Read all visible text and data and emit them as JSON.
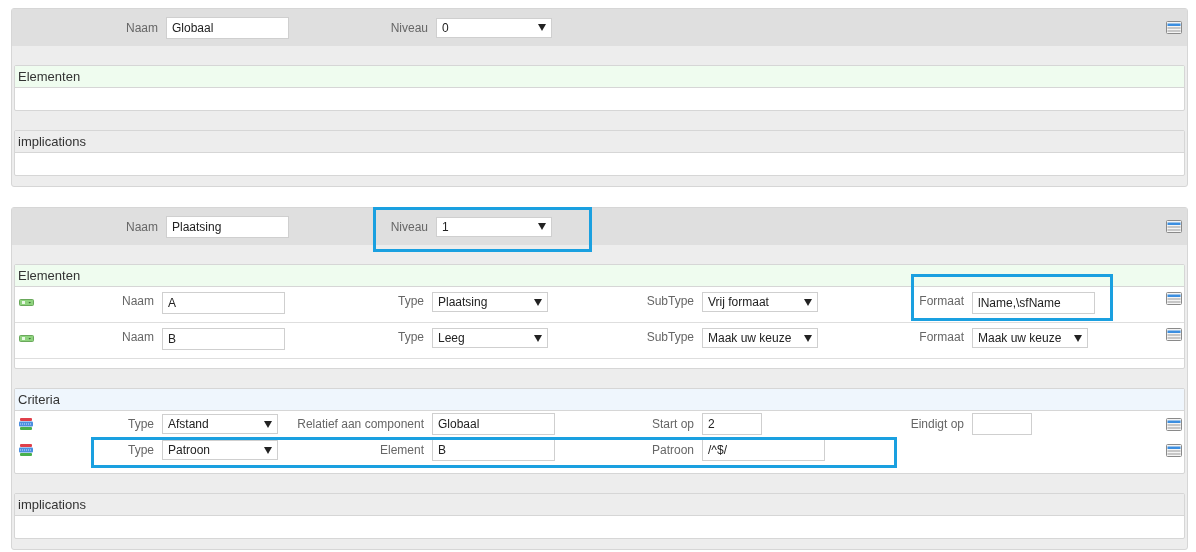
{
  "components": [
    {
      "header": {
        "fields": [
          {
            "label": "Naam",
            "kind": "text",
            "value": "Globaal",
            "highlighted": false
          },
          {
            "label": "Niveau",
            "kind": "select",
            "value": "0",
            "highlighted": false
          }
        ]
      },
      "sections": [
        {
          "kind": "elements",
          "title": "Elementen"
        },
        {
          "kind": "implications",
          "title": "implications"
        }
      ]
    },
    {
      "header": {
        "fields": [
          {
            "label": "Naam",
            "kind": "text",
            "value": "Plaatsing",
            "highlighted": false
          },
          {
            "label": "Niveau",
            "kind": "select",
            "value": "1",
            "highlighted": true
          }
        ]
      },
      "sections": [
        {
          "kind": "elements",
          "title": "Elementen",
          "rows": [
            {
              "highlighted": false,
              "fields": [
                {
                  "label": "Naam",
                  "kind": "text",
                  "value": "A",
                  "highlighted": false
                },
                {
                  "label": "Type",
                  "kind": "select",
                  "value": "Plaatsing",
                  "highlighted": false
                },
                {
                  "label": "SubType",
                  "kind": "select",
                  "value": "Vrij formaat",
                  "highlighted": false
                },
                {
                  "label": "Formaat",
                  "kind": "text",
                  "value": "lName,\\sfName",
                  "highlighted": true
                }
              ]
            },
            {
              "highlighted": false,
              "fields": [
                {
                  "label": "Naam",
                  "kind": "text",
                  "value": "B",
                  "highlighted": false
                },
                {
                  "label": "Type",
                  "kind": "select",
                  "value": "Leeg",
                  "highlighted": false
                },
                {
                  "label": "SubType",
                  "kind": "select",
                  "value": "Maak uw keuze",
                  "highlighted": false
                },
                {
                  "label": "Formaat",
                  "kind": "select",
                  "value": "Maak uw keuze",
                  "highlighted": false
                }
              ]
            }
          ]
        },
        {
          "kind": "criteria",
          "title": "Criteria",
          "rows": [
            {
              "highlighted": false,
              "fields": [
                {
                  "label": "Type",
                  "kind": "select",
                  "value": "Afstand",
                  "highlighted": false
                },
                {
                  "label": "Relatief aan component",
                  "kind": "text",
                  "value": "Globaal",
                  "highlighted": false
                },
                {
                  "label": "Start op",
                  "kind": "number",
                  "value": "2",
                  "highlighted": false
                },
                {
                  "label": "Eindigt op",
                  "kind": "number",
                  "highlighted": false
                }
              ]
            },
            {
              "highlighted": true,
              "fields": [
                {
                  "label": "Type",
                  "kind": "select",
                  "value": "Patroon",
                  "highlighted": false
                },
                {
                  "label": "Element",
                  "kind": "text",
                  "value": "B",
                  "highlighted": false
                },
                {
                  "label": "Patroon",
                  "kind": "text",
                  "value": "/^$/",
                  "highlighted": false
                }
              ]
            }
          ]
        },
        {
          "kind": "implications",
          "title": "implications"
        }
      ]
    }
  ]
}
